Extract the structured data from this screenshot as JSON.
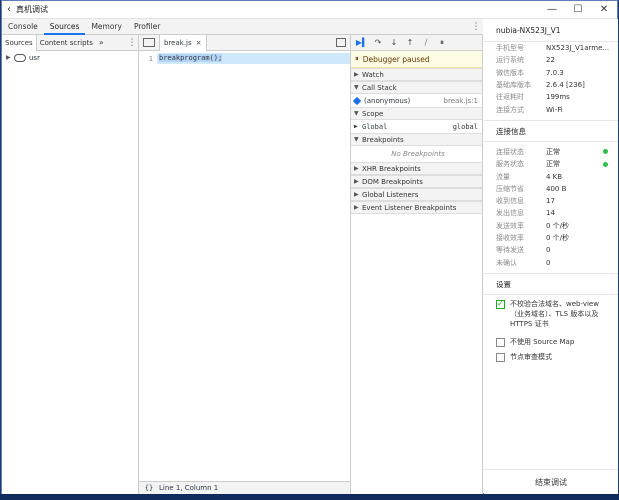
{
  "window": {
    "title": "真机调试"
  },
  "devtools_tabs": [
    "Console",
    "Sources",
    "Memory",
    "Profiler"
  ],
  "navigator": {
    "tabs": [
      "Sources",
      "Content scripts"
    ],
    "tree": [
      "usr"
    ]
  },
  "editor": {
    "file_tab": "break.js",
    "line_no": "1",
    "code": "breakprogram();",
    "status": "Line 1, Column 1",
    "braces": "{}"
  },
  "debugger": {
    "paused": "Debugger paused",
    "watch": "Watch",
    "call_stack": "Call Stack",
    "frame_name": "(anonymous)",
    "frame_loc": "break.js:1",
    "scope": "Scope",
    "scope_global": "Global",
    "scope_global_val": "global",
    "breakpoints": "Breakpoints",
    "no_breakpoints": "No Breakpoints",
    "xhr": "XHR Breakpoints",
    "dom": "DOM Breakpoints",
    "global_listeners": "Global Listeners",
    "event_listener": "Event Listener Breakpoints"
  },
  "device": {
    "name": "nubia-NX523J_V1",
    "info": [
      {
        "k": "手机型号",
        "v": "NX523J_V1arme..."
      },
      {
        "k": "运行系统",
        "v": "22"
      },
      {
        "k": "微信版本",
        "v": "7.0.3"
      },
      {
        "k": "基础库版本",
        "v": "2.6.4 [236]"
      },
      {
        "k": "往返耗时",
        "v": "199ms"
      },
      {
        "k": "连接方式",
        "v": "Wi-Fi"
      }
    ],
    "conn_title": "连接信息",
    "conn": [
      {
        "k": "连接状态",
        "v": "正常"
      },
      {
        "k": "服务状态",
        "v": "正常"
      },
      {
        "k": "流量",
        "v": "4 KB"
      },
      {
        "k": "压缩节省",
        "v": "400 B"
      },
      {
        "k": "收到信息",
        "v": "17"
      },
      {
        "k": "发出信息",
        "v": "14"
      },
      {
        "k": "发送效率",
        "v": "0 个/秒"
      },
      {
        "k": "接收效率",
        "v": "0 个/秒"
      },
      {
        "k": "等待发送",
        "v": "0"
      },
      {
        "k": "未确认",
        "v": "0"
      }
    ],
    "settings_title": "设置",
    "opt1": "不校验合法域名、web-view（业务域名）、TLS 版本以及 HTTPS 证书",
    "opt2": "不使用 Source Map",
    "opt3": "节点审查模式",
    "end_button": "结束调试"
  },
  "colors": {
    "accent": "#1a73e8",
    "ok_green": "#2fbf4a",
    "wechat_green": "#1aad19"
  }
}
